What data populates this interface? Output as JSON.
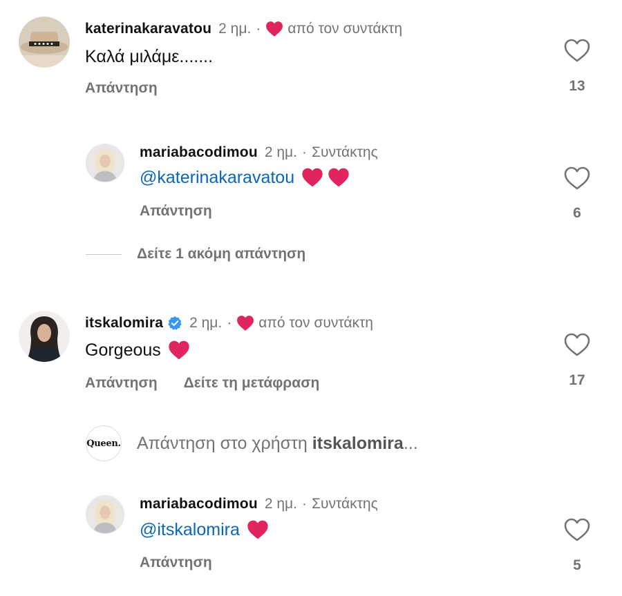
{
  "comments": [
    {
      "username": "katerinakaravatou",
      "time": "2 ημ.",
      "liked_by_author_text": "από τον συντάκτη",
      "text": "Καλά μιλάμε.......",
      "reply_label": "Απάντηση",
      "like_count": "13"
    },
    {
      "username": "mariabacodimou",
      "time": "2 ημ.",
      "role": "Συντάκτης",
      "mention": "@katerinakaravatou",
      "reply_label": "Απάντηση",
      "like_count": "6"
    },
    {
      "username": "itskalomira",
      "time": "2 ημ.",
      "liked_by_author_text": "από τον συντάκτη",
      "text": "Gorgeous",
      "reply_label": "Απάντηση",
      "translate_label": "Δείτε τη μετάφραση",
      "like_count": "17"
    },
    {
      "username": "mariabacodimou",
      "time": "2 ημ.",
      "role": "Συντάκτης",
      "mention": "@itskalomira",
      "reply_label": "Απάντηση",
      "like_count": "5"
    }
  ],
  "more_replies_label": "Δείτε 1 ακόμη απάντηση",
  "reply_box": {
    "avatar_text": "Queen.",
    "placeholder_prefix": "Απάντηση στο χρήστη",
    "placeholder_user": "itskalomira",
    "placeholder_suffix": "..."
  },
  "separator": "·",
  "colors": {
    "heart_red": "#e0245e",
    "mention_blue": "#0a66b8",
    "muted_gray": "#737373",
    "verified_blue": "#3897f0"
  },
  "icons": {
    "like": "heart-outline-icon",
    "liked_by_author": "heart-filled-icon",
    "verified": "verified-badge-icon"
  }
}
